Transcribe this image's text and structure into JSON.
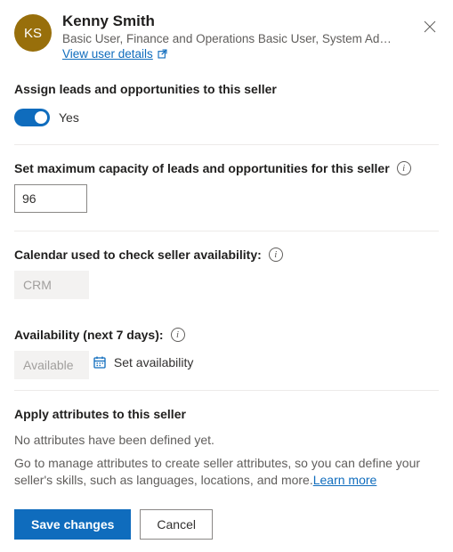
{
  "user": {
    "initials": "KS",
    "name": "Kenny Smith",
    "roles": "Basic User, Finance and Operations Basic User, System Administr…",
    "view_details": "View user details"
  },
  "assign": {
    "label": "Assign leads and opportunities to this seller",
    "toggle_value": "Yes"
  },
  "capacity": {
    "label": "Set maximum capacity of leads and opportunities for this seller",
    "value": "96"
  },
  "calendar": {
    "label": "Calendar used to check seller availability:",
    "value": "CRM"
  },
  "availability": {
    "label": "Availability (next 7 days):",
    "value": "Available",
    "set_label": "Set availability"
  },
  "attributes": {
    "heading": "Apply attributes to this seller",
    "empty": "No attributes have been defined yet.",
    "hint_pre": "Go to manage attributes to create seller attributes, so you can define your seller's skills, such as languages, locations, and more.",
    "learn_more": "Learn more"
  },
  "footer": {
    "save": "Save changes",
    "cancel": "Cancel"
  }
}
